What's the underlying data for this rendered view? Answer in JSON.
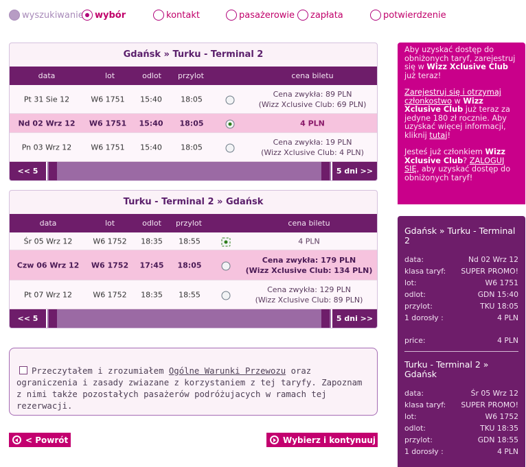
{
  "steps": [
    {
      "label": "wyszukiwanie",
      "state": "done"
    },
    {
      "label": "wybór",
      "state": "active"
    },
    {
      "label": "kontakt",
      "state": "todo"
    },
    {
      "label": "pasażerowie",
      "state": "todo"
    },
    {
      "label": "zapłata",
      "state": "todo"
    },
    {
      "label": "potwierdzenie",
      "state": "todo"
    }
  ],
  "table_headers": {
    "date": "data",
    "flight": "lot",
    "departure": "odlot",
    "arrival": "przylot",
    "price": "cena biletu"
  },
  "nav": {
    "prev": "<< 5 dni",
    "next": "5 dni >>"
  },
  "outbound": {
    "route": "Gdańsk » Turku - Terminal 2",
    "rows": [
      {
        "date": "Pt 31 Sie 12",
        "flight": "W6 1751",
        "dep": "15:40",
        "arr": "18:05",
        "price1": "Cena zwykła: 89 PLN",
        "price2": "(Wizz Xclusive Club: 69 PLN)",
        "selected": false
      },
      {
        "date": "Nd 02 Wrz 12",
        "flight": "W6 1751",
        "dep": "15:40",
        "arr": "18:05",
        "price1": "4 PLN",
        "price2": "",
        "selected": true
      },
      {
        "date": "Pn 03 Wrz 12",
        "flight": "W6 1751",
        "dep": "15:40",
        "arr": "18:05",
        "price1": "Cena zwykła: 19 PLN",
        "price2": "(Wizz Xclusive Club: 4 PLN)",
        "selected": false
      }
    ]
  },
  "return": {
    "route": "Turku - Terminal 2 » Gdańsk",
    "rows": [
      {
        "date": "Śr 05 Wrz 12",
        "flight": "W6 1752",
        "dep": "18:35",
        "arr": "18:55",
        "price1": "4 PLN",
        "price2": "",
        "selected": true
      },
      {
        "date": "Czw 06 Wrz 12",
        "flight": "W6 1752",
        "dep": "17:45",
        "arr": "18:05",
        "price1": "Cena zwykła: 179 PLN",
        "price2": "(Wizz Xclusive Club: 134 PLN)",
        "selected": false
      },
      {
        "date": "Pt 07 Wrz 12",
        "flight": "W6 1752",
        "dep": "18:35",
        "arr": "18:55",
        "price1": "Cena zwykła: 129 PLN",
        "price2": "(Wizz Xclusive Club: 89 PLN)",
        "selected": false
      }
    ]
  },
  "terms": {
    "before": "Przeczytałem i zrozumiałem ",
    "link": "Ogólne Warunki Przewozu",
    "after": " oraz ograniczenia i zasady zwiazane z korzystaniem z tej taryfy. Zapoznam z nimi także pozostałych pasażerów podróżujacych w ramach tej rezerwacji."
  },
  "buttons": {
    "back": "< Powrót",
    "continue": "Wybierz i kontynuuj >"
  },
  "promo": {
    "p1a": "Aby uzyskać dostęp do obniżonych taryf, zarejestruj się w ",
    "p1b": "Wizz Xclusive Club",
    "p1c": " już teraz!",
    "p2a": "Zarejestruj się i otrzymaj członkostwo",
    "p2b": " w ",
    "p2c": "Wizz Xclusive Club",
    "p2d": " już teraz za jedyne 180 zł rocznie. Aby uzyskać więcej informacji, kliknij ",
    "p2e": "tutaj",
    "p2f": "!",
    "p3a": "Jesteś już członkiem ",
    "p3b": "Wizz Xclusive Club",
    "p3c": "? ",
    "p3d": "ZALOGUJ SIĘ",
    "p3e": ", aby uzyskać dostęp do obniżonych taryf!"
  },
  "summary": {
    "outbound": {
      "route": "Gdańsk » Turku - Terminal 2",
      "lines": [
        {
          "k": "data:",
          "v": "Nd 02 Wrz 12"
        },
        {
          "k": "klasa taryf:",
          "v": "SUPER PROMO!"
        },
        {
          "k": "lot:",
          "v": "W6 1751"
        },
        {
          "k": "odlot:",
          "v": "GDN 15:40"
        },
        {
          "k": "przylot:",
          "v": "TKU 18:05"
        },
        {
          "k": "1 dorosły :",
          "v": "4 PLN"
        }
      ],
      "price_label": "price:",
      "price_value": "4 PLN"
    },
    "return": {
      "route": "Turku - Terminal 2 » Gdańsk",
      "lines": [
        {
          "k": "data:",
          "v": "Śr 05 Wrz 12"
        },
        {
          "k": "klasa taryf:",
          "v": "SUPER PROMO!"
        },
        {
          "k": "lot:",
          "v": "W6 1752"
        },
        {
          "k": "odlot:",
          "v": "TKU 18:35"
        },
        {
          "k": "przylot:",
          "v": "GDN 18:55"
        },
        {
          "k": "1 dorosły :",
          "v": "4 PLN"
        }
      ]
    }
  }
}
